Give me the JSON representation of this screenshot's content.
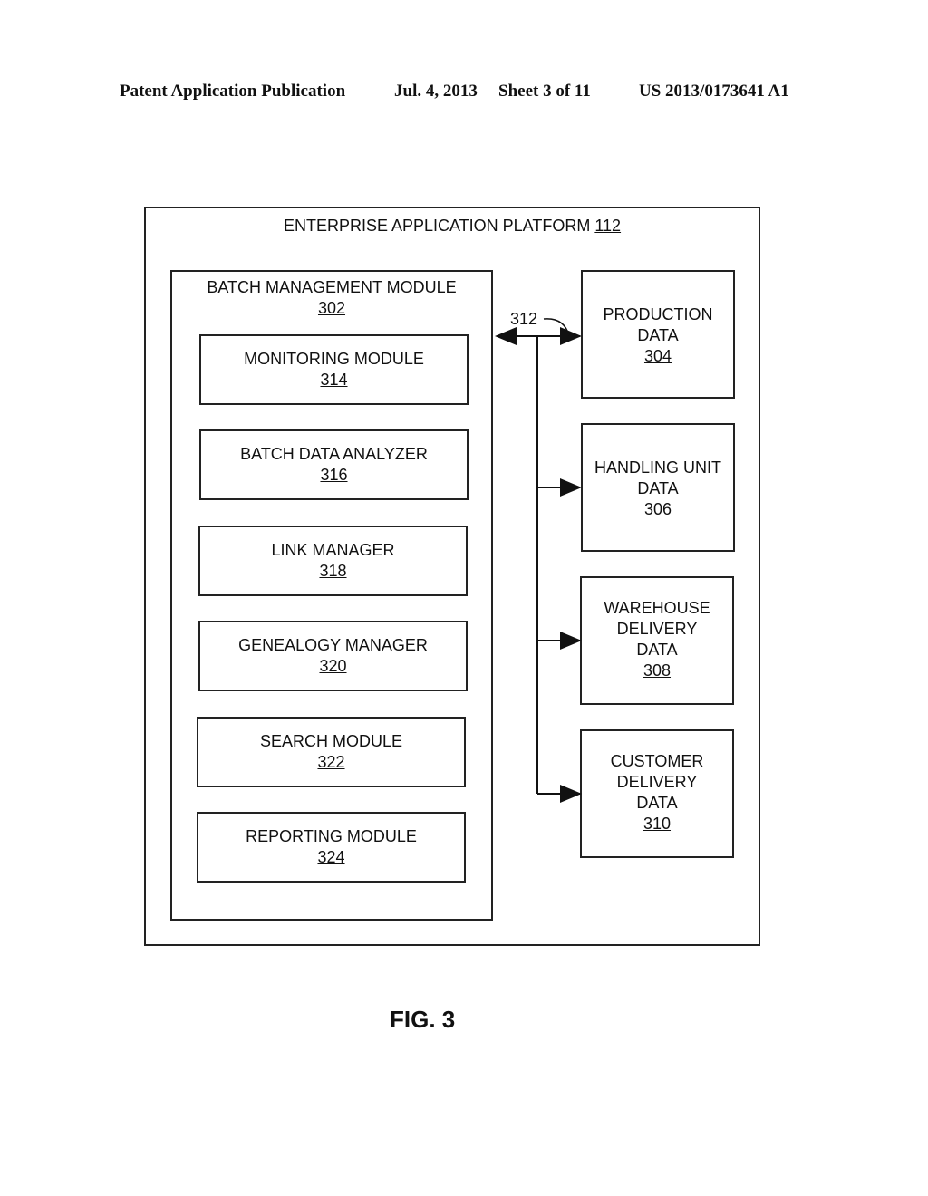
{
  "header": {
    "left": "Patent Application Publication",
    "date": "Jul. 4, 2013",
    "sheet": "Sheet 3 of 11",
    "pub_number": "US 2013/0173641 A1"
  },
  "platform": {
    "title": "ENTERPRISE APPLICATION PLATFORM",
    "ref": "112"
  },
  "batch_module": {
    "title": "BATCH MANAGEMENT MODULE",
    "ref": "302",
    "submodules": [
      {
        "label": "MONITORING MODULE",
        "ref": "314"
      },
      {
        "label": "BATCH DATA ANALYZER",
        "ref": "316"
      },
      {
        "label": "LINK MANAGER",
        "ref": "318"
      },
      {
        "label": "GENEALOGY MANAGER",
        "ref": "320"
      },
      {
        "label": "SEARCH MODULE",
        "ref": "322"
      },
      {
        "label": "REPORTING MODULE",
        "ref": "324"
      }
    ]
  },
  "connector": {
    "ref": "312"
  },
  "data_stores": [
    {
      "lines": [
        "PRODUCTION",
        "DATA"
      ],
      "ref": "304"
    },
    {
      "lines": [
        "HANDLING UNIT",
        "DATA"
      ],
      "ref": "306"
    },
    {
      "lines": [
        "WAREHOUSE",
        "DELIVERY",
        "DATA"
      ],
      "ref": "308"
    },
    {
      "lines": [
        "CUSTOMER",
        "DELIVERY",
        "DATA"
      ],
      "ref": "310"
    }
  ],
  "figure_label": "FIG. 3"
}
